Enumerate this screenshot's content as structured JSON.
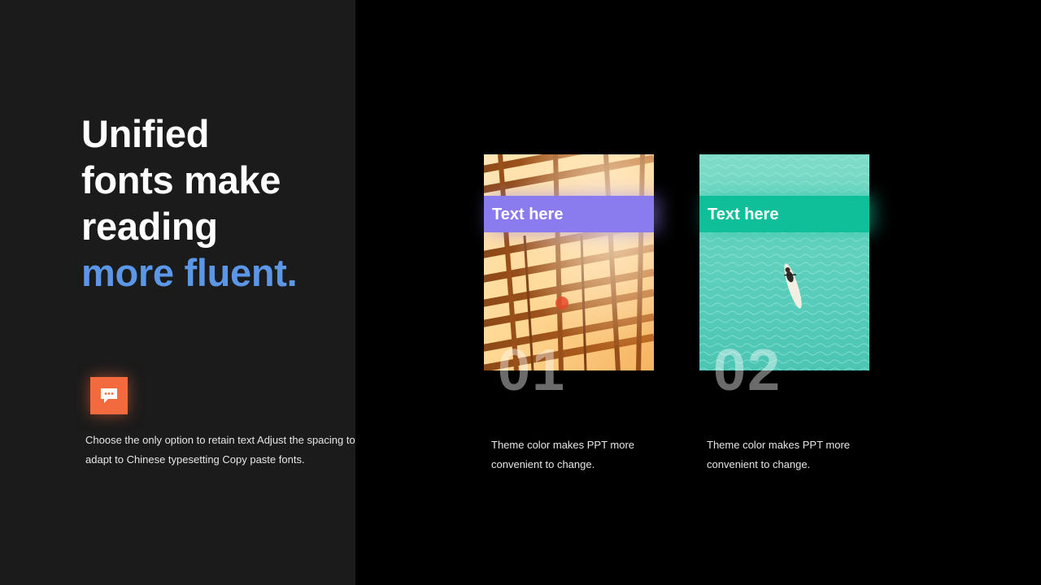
{
  "headline": {
    "line1": "Unified",
    "line2": "fonts make",
    "line3": "reading",
    "line4": "more fluent."
  },
  "intro_text": "Choose the only option to retain text Adjust the spacing to adapt to Chinese typesetting Copy paste fonts.",
  "cards": [
    {
      "label": "Text here",
      "number": "01",
      "caption": "Theme color makes PPT more convenient to change.",
      "color": "#8a7cee"
    },
    {
      "label": "Text here",
      "number": "02",
      "caption": "Theme color makes PPT more convenient to change.",
      "color": "#0fbf9a"
    }
  ],
  "colors": {
    "left_panel": "#1b1b1b",
    "background": "#000000",
    "accent_blue": "#5b97e6",
    "badge_orange": "#f26a3d"
  },
  "icons": {
    "badge": "chat-bubble-icon"
  }
}
